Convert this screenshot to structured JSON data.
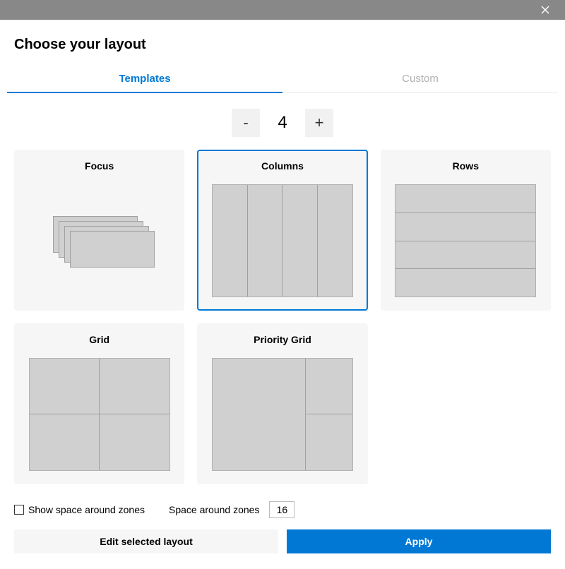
{
  "dialog": {
    "title": "Choose your layout"
  },
  "tabs": {
    "templates": "Templates",
    "custom": "Custom"
  },
  "stepper": {
    "decrement": "-",
    "increment": "+",
    "value": "4"
  },
  "templates": {
    "focus": "Focus",
    "columns": "Columns",
    "rows": "Rows",
    "grid": "Grid",
    "priority_grid": "Priority Grid"
  },
  "options": {
    "show_space_label": "Show space around zones",
    "space_label": "Space around zones",
    "space_value": "16"
  },
  "buttons": {
    "edit": "Edit selected layout",
    "apply": "Apply"
  }
}
